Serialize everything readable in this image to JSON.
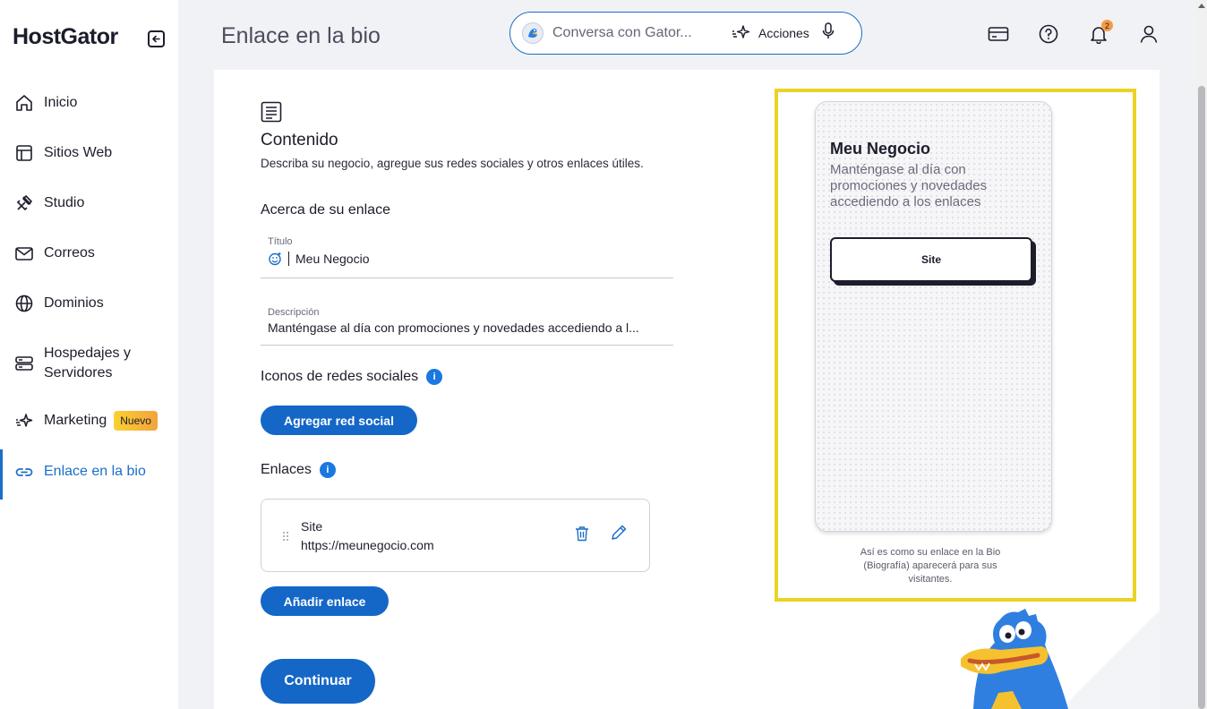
{
  "app": {
    "logo": "HostGator"
  },
  "sidebar": {
    "items": [
      {
        "label": "Inicio",
        "icon": "home-icon"
      },
      {
        "label": "Sitios Web",
        "icon": "layout-icon"
      },
      {
        "label": "Studio",
        "icon": "tools-icon"
      },
      {
        "label": "Correos",
        "icon": "mail-icon"
      },
      {
        "label": "Dominios",
        "icon": "globe-icon"
      },
      {
        "label": "Hospedajes y Servidores",
        "icon": "server-icon"
      },
      {
        "label": "Marketing",
        "icon": "sparkle-icon",
        "badge": "Nuevo"
      },
      {
        "label": "Enlace en la bio",
        "icon": "link-icon",
        "active": true
      }
    ]
  },
  "header": {
    "title": "Enlace en la bio",
    "search_placeholder": "Conversa con Gator...",
    "actions_label": "Acciones",
    "notification_count": "2",
    "icons": [
      "billing-card-icon",
      "help-icon",
      "bell-icon",
      "user-icon"
    ]
  },
  "content": {
    "title": "Contenido",
    "description": "Describa su negocio, agregue sus redes sociales y otros enlaces útiles.",
    "about_heading": "Acerca de su enlace",
    "title_field": {
      "label": "Título",
      "value": "Meu Negocio"
    },
    "description_field": {
      "label": "Descripción",
      "value": "Manténgase al día con promociones y novedades accediendo a l..."
    },
    "social_heading": "Iconos de redes sociales",
    "add_social_label": "Agregar red social",
    "links_heading": "Enlaces",
    "links": [
      {
        "name": "Site",
        "url": "https://meunegocio.com"
      }
    ],
    "add_link_label": "Añadir enlace",
    "continue_label": "Continuar"
  },
  "preview": {
    "title": "Meu Negocio",
    "description": "Manténgase al día con promociones y novedades accediendo a los enlaces",
    "button_label": "Site",
    "caption": "Así es como su enlace en la Bio (Biografía) aparecerá para sus visitantes."
  },
  "colors": {
    "accent": "#1a6fc6",
    "button": "#1467c7",
    "preview_border": "#ecd224",
    "badge": "#fbd034"
  }
}
